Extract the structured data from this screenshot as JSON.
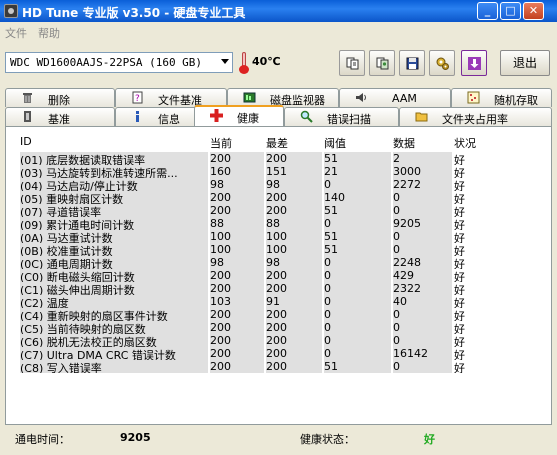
{
  "window": {
    "title": "HD Tune 专业版 v3.50 - 硬盘专业工具"
  },
  "menu": [
    "文件",
    "帮助"
  ],
  "toolbar": {
    "drive": "WDC WD1600AAJS-22PSA (160 GB)",
    "temperature": "40℃",
    "exit_label": "退出"
  },
  "tabs_top": [
    "删除",
    "文件基准",
    "磁盘监视器",
    "AAM",
    "随机存取"
  ],
  "tabs_bottom": [
    "基准",
    "信息",
    "健康",
    "错误扫描",
    "文件夹占用率"
  ],
  "active_tab": "健康",
  "table": {
    "headers": [
      "ID",
      "当前",
      "最差",
      "阈值",
      "数据",
      "状况"
    ],
    "rows": [
      {
        "id": "(01) 底层数据读取错误率",
        "cur": "200",
        "worst": "200",
        "thr": "51",
        "data": "2",
        "status": "好"
      },
      {
        "id": "(03) 马达旋转到标准转速所需...",
        "cur": "160",
        "worst": "151",
        "thr": "21",
        "data": "3000",
        "status": "好"
      },
      {
        "id": "(04) 马达启动/停止计数",
        "cur": "98",
        "worst": "98",
        "thr": "0",
        "data": "2272",
        "status": "好"
      },
      {
        "id": "(05) 重映射扇区计数",
        "cur": "200",
        "worst": "200",
        "thr": "140",
        "data": "0",
        "status": "好"
      },
      {
        "id": "(07) 寻道错误率",
        "cur": "200",
        "worst": "200",
        "thr": "51",
        "data": "0",
        "status": "好"
      },
      {
        "id": "(09) 累计通电时间计数",
        "cur": "88",
        "worst": "88",
        "thr": "0",
        "data": "9205",
        "status": "好"
      },
      {
        "id": "(0A) 马达重试计数",
        "cur": "100",
        "worst": "100",
        "thr": "51",
        "data": "0",
        "status": "好"
      },
      {
        "id": "(0B) 校准重试计数",
        "cur": "100",
        "worst": "100",
        "thr": "51",
        "data": "0",
        "status": "好"
      },
      {
        "id": "(0C) 通电周期计数",
        "cur": "98",
        "worst": "98",
        "thr": "0",
        "data": "2248",
        "status": "好"
      },
      {
        "id": "(C0) 断电磁头缩回计数",
        "cur": "200",
        "worst": "200",
        "thr": "0",
        "data": "429",
        "status": "好"
      },
      {
        "id": "(C1) 磁头伸出周期计数",
        "cur": "200",
        "worst": "200",
        "thr": "0",
        "data": "2322",
        "status": "好"
      },
      {
        "id": "(C2) 温度",
        "cur": "103",
        "worst": "91",
        "thr": "0",
        "data": "40",
        "status": "好"
      },
      {
        "id": "(C4) 重新映射的扇区事件计数",
        "cur": "200",
        "worst": "200",
        "thr": "0",
        "data": "0",
        "status": "好"
      },
      {
        "id": "(C5) 当前待映射的扇区数",
        "cur": "200",
        "worst": "200",
        "thr": "0",
        "data": "0",
        "status": "好"
      },
      {
        "id": "(C6) 脱机无法校正的扇区数",
        "cur": "200",
        "worst": "200",
        "thr": "0",
        "data": "0",
        "status": "好"
      },
      {
        "id": "(C7) Ultra DMA CRC 错误计数",
        "cur": "200",
        "worst": "200",
        "thr": "0",
        "data": "16142",
        "status": "好"
      },
      {
        "id": "(C8) 写入错误率",
        "cur": "200",
        "worst": "200",
        "thr": "51",
        "data": "0",
        "status": "好"
      }
    ]
  },
  "status": {
    "power_on_label": "通电时间：",
    "power_on_value": "9205",
    "health_label": "健康状态：",
    "health_value": "好",
    "health_color": "#22aa22"
  }
}
